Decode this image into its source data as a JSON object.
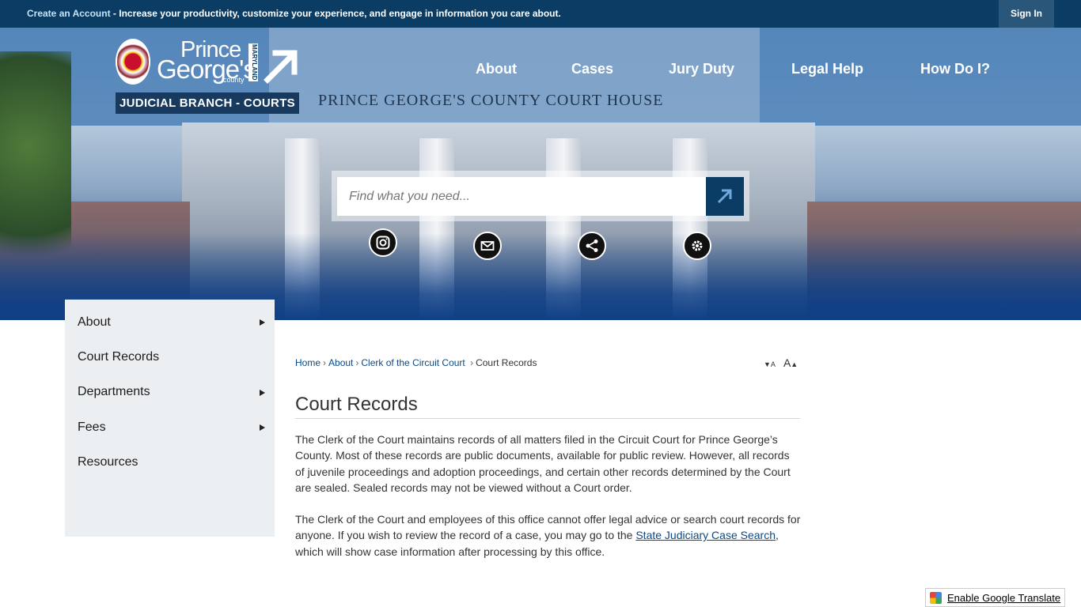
{
  "topbar": {
    "create_account": "Create an Account",
    "message": " - Increase your productivity, customize your experience, and engage in information you care about.",
    "sign_in": "Sign In"
  },
  "logo": {
    "line1": "Prince",
    "line2": "George's",
    "county": "county",
    "state": "MARYLAND",
    "branch": "JUDICIAL BRANCH - COURTS"
  },
  "hero": {
    "building_text": "PRINCE GEORGE'S COUNTY COURT HOUSE"
  },
  "nav": {
    "items": [
      "About",
      "Cases",
      "Jury Duty",
      "Legal Help",
      "How Do I?"
    ]
  },
  "search": {
    "placeholder": "Find what you need..."
  },
  "social": {
    "icons": [
      "instagram-icon",
      "mail-icon",
      "share-icon",
      "gear-icon"
    ]
  },
  "sidebar": {
    "items": [
      {
        "label": "About",
        "has_children": true
      },
      {
        "label": "Court Records",
        "has_children": false
      },
      {
        "label": "Departments",
        "has_children": true
      },
      {
        "label": "Fees",
        "has_children": true
      },
      {
        "label": "Resources",
        "has_children": false
      }
    ]
  },
  "breadcrumb": {
    "items": [
      "Home",
      "About",
      "Clerk of the Circuit Court",
      "Court Records"
    ],
    "font_decrease": "A",
    "font_increase": "A"
  },
  "content": {
    "title": "Court Records",
    "para1": "The Clerk of the Court maintains records of all matters filed in the Circuit Court for Prince George’s County. Most of these records are public documents, available for public review. However, all records of juvenile proceedings and adoption proceedings, and certain other records determined by the Court are sealed. Sealed records may not be viewed without a Court order.",
    "para2_before": "The Clerk of the Court and employees of this office cannot offer legal advice or search court records for anyone. If you wish to review the record of a case, you may go to the ",
    "para2_link": "State Judiciary Case Search",
    "para2_after": ", which will show case information after processing by this office."
  },
  "translate": {
    "label": "Enable Google Translate"
  },
  "colors": {
    "primary_dark": "#0b3d64",
    "link": "#0b4a86",
    "sidebar_bg": "#eceff2"
  }
}
